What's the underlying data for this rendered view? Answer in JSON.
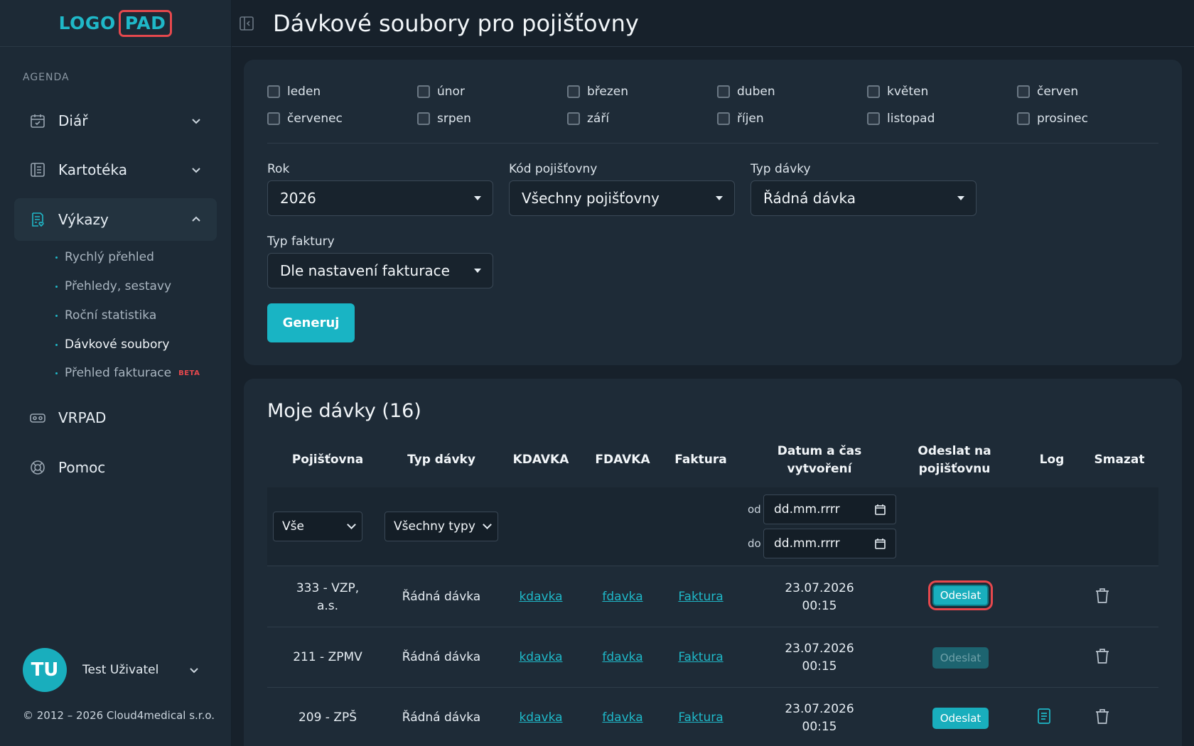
{
  "logo": {
    "part1": "LOGO",
    "part2": "PAD"
  },
  "sidebar": {
    "section_label": "AGENDA",
    "items": [
      {
        "label": "Diář",
        "icon": "calendar-check-icon"
      },
      {
        "label": "Kartotéka",
        "icon": "folder-list-icon"
      },
      {
        "label": "Výkazy",
        "icon": "report-icon"
      },
      {
        "label": "VRPAD",
        "icon": "vr-headset-icon"
      },
      {
        "label": "Pomoc",
        "icon": "lifebuoy-icon"
      }
    ],
    "sub_items": [
      {
        "label": "Rychlý přehled"
      },
      {
        "label": "Přehledy, sestavy"
      },
      {
        "label": "Roční statistika"
      },
      {
        "label": "Dávkové soubory"
      },
      {
        "label": "Přehled fakturace",
        "badge": "BETA"
      }
    ]
  },
  "user": {
    "initials": "TU",
    "name": "Test Uživatel"
  },
  "copyright": "© 2012 – 2026 Cloud4medical s.r.o.",
  "header": {
    "title": "Dávkové soubory pro pojišťovny"
  },
  "filters": {
    "months": [
      "leden",
      "únor",
      "březen",
      "duben",
      "květen",
      "červen",
      "červenec",
      "srpen",
      "září",
      "říjen",
      "listopad",
      "prosinec"
    ],
    "rok": {
      "label": "Rok",
      "value": "2026"
    },
    "kod": {
      "label": "Kód pojišťovny",
      "value": "Všechny pojišťovny"
    },
    "typ_davky": {
      "label": "Typ dávky",
      "value": "Řádná dávka"
    },
    "typ_faktury": {
      "label": "Typ faktury",
      "value": "Dle nastavení fakturace"
    },
    "generate_label": "Generuj"
  },
  "batches": {
    "title": "Moje dávky (16)",
    "headers": {
      "pojistovna": "Pojišťovna",
      "typ": "Typ dávky",
      "kdavka": "KDAVKA",
      "fdavka": "FDAVKA",
      "faktura": "Faktura",
      "datum_l1": "Datum a čas",
      "datum_l2": "vytvoření",
      "odeslat_l1": "Odeslat na",
      "odeslat_l2": "pojišťovnu",
      "log": "Log",
      "smazat": "Smazat"
    },
    "filter": {
      "pojistovna": "Vše",
      "typ": "Všechny typy",
      "od_label": "od",
      "do_label": "do",
      "date_placeholder": "dd.mm.rrrr"
    },
    "rows": [
      {
        "pojistovna_l1": "333 - VZP,",
        "pojistovna_l2": "a.s.",
        "typ": "Řádná dávka",
        "kdavka": "kdavka",
        "fdavka": "fdavka",
        "faktura": "Faktura",
        "date": "23.07.2026",
        "time": "00:15",
        "send": "Odeslat"
      },
      {
        "pojistovna_l1": "211 - ZPMV",
        "typ": "Řádná dávka",
        "kdavka": "kdavka",
        "fdavka": "fdavka",
        "faktura": "Faktura",
        "date": "23.07.2026",
        "time": "00:15",
        "send": "Odeslat"
      },
      {
        "pojistovna_l1": "209 - ZPŠ",
        "typ": "Řádná dávka",
        "kdavka": "kdavka",
        "fdavka": "fdavka",
        "faktura": "Faktura",
        "date": "23.07.2026",
        "time": "00:15",
        "send": "Odeslat"
      }
    ]
  },
  "colors": {
    "accent": "#19b4c4",
    "highlight": "#e5484d",
    "beta": "#e5484d"
  }
}
